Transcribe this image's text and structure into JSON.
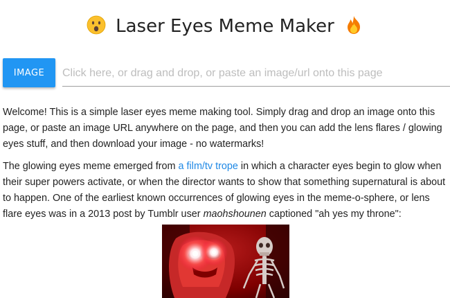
{
  "header": {
    "title": "Laser Eyes Meme Maker",
    "left_emoji": "face-with-open-mouth-icon",
    "right_emoji": "fire-icon"
  },
  "toolbar": {
    "image_button_label": "IMAGE",
    "input_placeholder": "Click here, or drag and drop, or paste an image/url onto this page",
    "input_value": ""
  },
  "intro": {
    "text": "Welcome! This is a simple laser eyes meme making tool. Simply drag and drop an image onto this page, or paste an image URL anywhere on the page, and then you can add the lens flares / glowing eyes stuff, and then download your image - no watermarks!"
  },
  "history": {
    "part1": "The glowing eyes meme emerged from ",
    "link_text": "a film/tv trope",
    "part2": " in which a character eyes begin to glow when their super powers activate, or when the director wants to show that something supernatural is about to happen. One of the earliest known occurrences of glowing eyes in the meme-o-sphere, or lens flare eyes was in a 2013 post by Tumblr user ",
    "username": "maohshounen",
    "part3": " captioned \"ah yes my throne\":"
  },
  "colors": {
    "button_blue": "#2196f3",
    "link_blue": "#1e88e5",
    "placeholder_gray": "#bdbdbd"
  }
}
